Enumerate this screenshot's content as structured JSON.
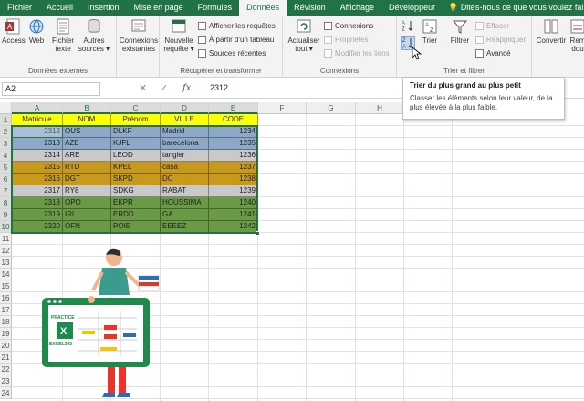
{
  "tabs": [
    {
      "label": "Fichier",
      "active": false
    },
    {
      "label": "Accueil",
      "active": false
    },
    {
      "label": "Insertion",
      "active": false
    },
    {
      "label": "Mise en page",
      "active": false
    },
    {
      "label": "Formules",
      "active": false
    },
    {
      "label": "Données",
      "active": true
    },
    {
      "label": "Révision",
      "active": false
    },
    {
      "label": "Affichage",
      "active": false
    },
    {
      "label": "Développeur",
      "active": false
    }
  ],
  "tell_me": "Dites-nous ce que vous voulez faire.",
  "ribbon": {
    "external": {
      "label": "Données externes",
      "access": "Access",
      "web": "Web",
      "file_text_1": "Fichier",
      "file_text_2": "texte",
      "other_1": "Autres",
      "other_2": "sources ▾",
      "existing_1": "Connexions",
      "existing_2": "existantes"
    },
    "transform": {
      "label": "Récupérer et transformer",
      "new_query_1": "Nouvelle",
      "new_query_2": "requête ▾",
      "show_queries": "Afficher les requêtes",
      "from_table": "À partir d'un tableau",
      "recent_sources": "Sources récentes"
    },
    "connections": {
      "label": "Connexions",
      "refresh_1": "Actualiser",
      "refresh_2": "tout ▾",
      "connections": "Connexions",
      "properties": "Propriétés",
      "edit_links": "Modifier les liens"
    },
    "sort": {
      "label": "Trier et filtrer",
      "sort": "Trier",
      "filter": "Filtrer",
      "clear": "Effacer",
      "reapply": "Réappliquer",
      "advanced": "Avancé"
    },
    "tools": {
      "convert": "Convertir",
      "remove_1": "Rem",
      "remove_2": "dou"
    }
  },
  "formula_bar": {
    "name_box": "A2",
    "value": "2312"
  },
  "tooltip": {
    "title": "Trier du plus grand au plus petit",
    "body": "Classer les éléments selon leur valeur, de la plus élevée à la plus faible."
  },
  "columns": [
    "A",
    "B",
    "C",
    "D",
    "E",
    "F",
    "G",
    "H",
    "I"
  ],
  "rows": [
    "1",
    "2",
    "3",
    "4",
    "5",
    "6",
    "7",
    "8",
    "9",
    "10",
    "11",
    "12",
    "13",
    "14",
    "15",
    "16",
    "17",
    "18",
    "19",
    "20",
    "21",
    "22",
    "23",
    "24"
  ],
  "table": {
    "headers": [
      "Matricule",
      "NOM",
      "Prénom",
      "VILLE",
      "CODE"
    ],
    "rows": [
      {
        "cells": [
          "2312",
          "OUS",
          "DLKF",
          "Madrid",
          "1234"
        ],
        "color": "#8ea9c8"
      },
      {
        "cells": [
          "2313",
          "AZE",
          "KJFL",
          "barecelona",
          "1235"
        ],
        "color": "#8ea9c8"
      },
      {
        "cells": [
          "2314",
          "ARE",
          "LEOD",
          "tangier",
          "1236"
        ],
        "color": "#c9c9c9"
      },
      {
        "cells": [
          "2315",
          "RTD",
          "KPEL",
          "casa",
          "1237"
        ],
        "color": "#c79a1e"
      },
      {
        "cells": [
          "2316",
          "DGT",
          "SKPD",
          "DC",
          "1238"
        ],
        "color": "#c79a1e"
      },
      {
        "cells": [
          "2317",
          "RY8",
          "SDKG",
          "RABAT",
          "1239"
        ],
        "color": "#c9c9c9"
      },
      {
        "cells": [
          "2318",
          "OPO",
          "EKPR",
          "HOUSSIMA",
          "1240"
        ],
        "color": "#6a9a46"
      },
      {
        "cells": [
          "2319",
          "IRL",
          "ERDD",
          "GA",
          "1241"
        ],
        "color": "#6a9a46"
      },
      {
        "cells": [
          "2320",
          "OFN",
          "POIE",
          "EEEEZ",
          "1242"
        ],
        "color": "#6a9a46"
      }
    ],
    "header_color": "#ffff00"
  },
  "illustration": {
    "board_title_1": "PRACTICE",
    "board_title_2": "EXCEL365"
  },
  "colors": {
    "excel_green": "#217346"
  }
}
